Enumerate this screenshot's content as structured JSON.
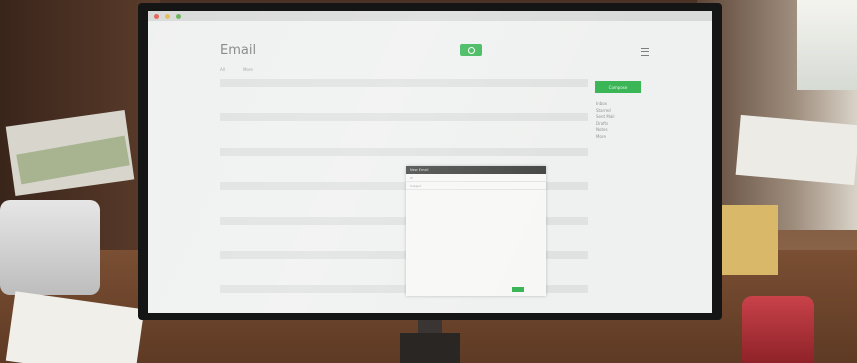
{
  "app": {
    "title": "Email"
  },
  "toolbar": {
    "select_label": "All",
    "more_label": "More"
  },
  "folders": [
    "Inbox",
    "Starred",
    "Sent Mail",
    "Drafts",
    "Notes",
    "More"
  ],
  "compose_label": "Compose",
  "popup": {
    "title": "New Email",
    "to_placeholder": "To",
    "subject_placeholder": "Subject"
  },
  "rows": [
    {
      "sender": "",
      "subject": "",
      "time": ""
    },
    {
      "sender": "",
      "subject": "",
      "time": ""
    },
    {
      "sender": "",
      "subject": "",
      "time": ""
    },
    {
      "sender": "",
      "subject": "",
      "time": ""
    },
    {
      "sender": "",
      "subject": "",
      "time": ""
    },
    {
      "sender": "",
      "subject": "",
      "time": ""
    },
    {
      "sender": "",
      "subject": "",
      "time": ""
    },
    {
      "sender": "",
      "subject": "",
      "time": ""
    },
    {
      "sender": "",
      "subject": "",
      "time": ""
    },
    {
      "sender": "",
      "subject": "",
      "time": ""
    },
    {
      "sender": "",
      "subject": "",
      "time": ""
    },
    {
      "sender": "",
      "subject": "",
      "time": ""
    },
    {
      "sender": "",
      "subject": "",
      "time": ""
    },
    {
      "sender": "",
      "subject": "",
      "time": ""
    },
    {
      "sender": "",
      "subject": "",
      "time": ""
    },
    {
      "sender": "",
      "subject": "",
      "time": ""
    },
    {
      "sender": "",
      "subject": "",
      "time": ""
    },
    {
      "sender": "",
      "subject": "",
      "time": ""
    },
    {
      "sender": "",
      "subject": "",
      "time": ""
    },
    {
      "sender": "",
      "subject": "",
      "time": ""
    },
    {
      "sender": "",
      "subject": "",
      "time": ""
    },
    {
      "sender": "",
      "subject": "",
      "time": ""
    },
    {
      "sender": "",
      "subject": "",
      "time": ""
    },
    {
      "sender": "",
      "subject": "",
      "time": ""
    },
    {
      "sender": "",
      "subject": "",
      "time": ""
    },
    {
      "sender": "",
      "subject": "",
      "time": ""
    }
  ],
  "colors": {
    "accent": "#2fb24d",
    "screen_bg": "#eef0ef",
    "bezel": "#151515"
  }
}
